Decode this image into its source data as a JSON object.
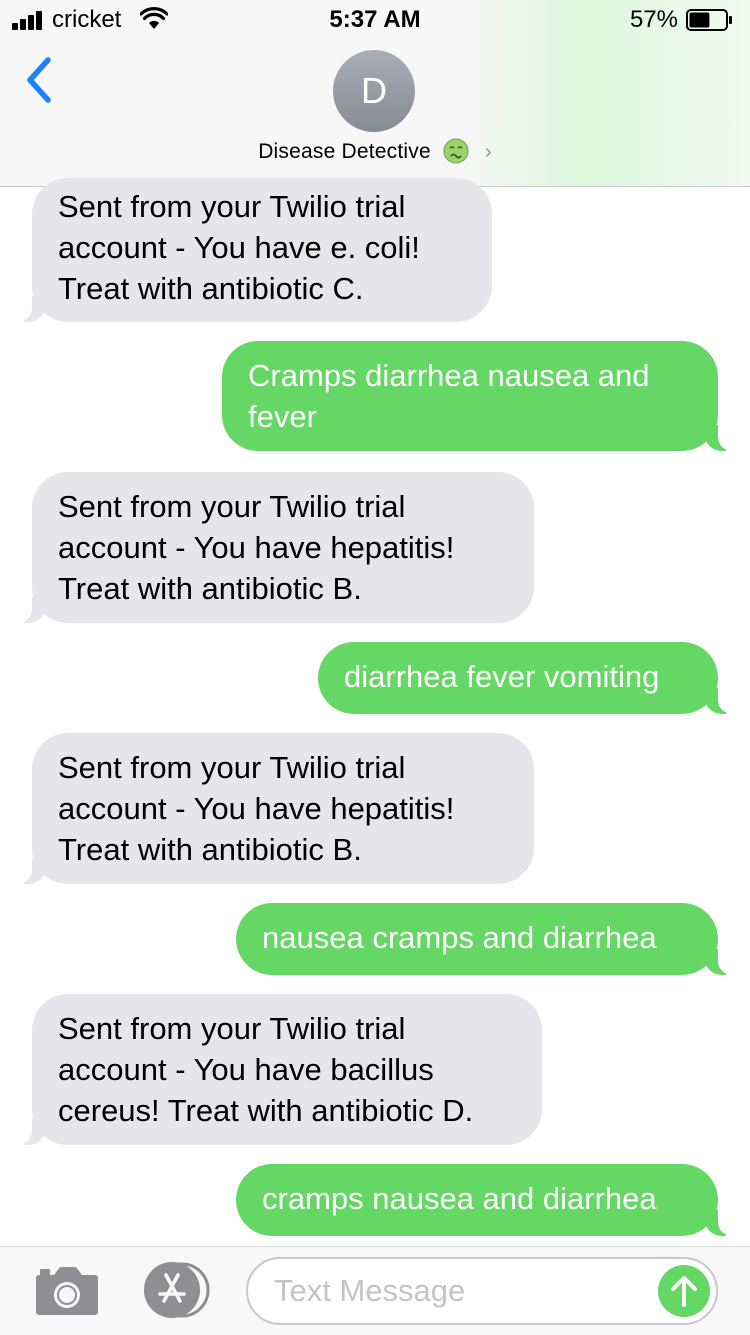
{
  "status_bar": {
    "carrier": "cricket",
    "time": "5:37 AM",
    "battery_percent": "57%",
    "battery_level": 0.57
  },
  "header": {
    "back_icon": "chevron-left-icon",
    "avatar_initial": "D",
    "contact_name": "Disease Detective",
    "contact_emoji": "nauseated-face-icon",
    "chevron_icon": "chevron-right-icon"
  },
  "messages": [
    {
      "direction": "incoming",
      "text": "Sent from your Twilio trial account - You have e. coli! Treat with antibiotic C."
    },
    {
      "direction": "outgoing",
      "text": "Cramps diarrhea nausea and fever"
    },
    {
      "direction": "incoming",
      "text": "Sent from your Twilio trial account - You have hepatitis! Treat with antibiotic B."
    },
    {
      "direction": "outgoing",
      "text": "diarrhea fever vomiting"
    },
    {
      "direction": "incoming",
      "text": "Sent from your Twilio trial account - You have hepatitis! Treat with antibiotic B."
    },
    {
      "direction": "outgoing",
      "text": "nausea cramps and diarrhea"
    },
    {
      "direction": "incoming",
      "text": "Sent from your Twilio trial account - You have bacillus cereus! Treat with antibiotic D."
    },
    {
      "direction": "outgoing",
      "text": "cramps nausea and diarrhea"
    }
  ],
  "input_bar": {
    "placeholder": "Text Message",
    "camera_icon": "camera-icon",
    "apps_icon": "app-store-icon",
    "send_icon": "arrow-up-icon"
  },
  "colors": {
    "outgoing_bubble": "#65d764",
    "incoming_bubble": "#e5e5ea",
    "accent": "#1a82fb"
  }
}
